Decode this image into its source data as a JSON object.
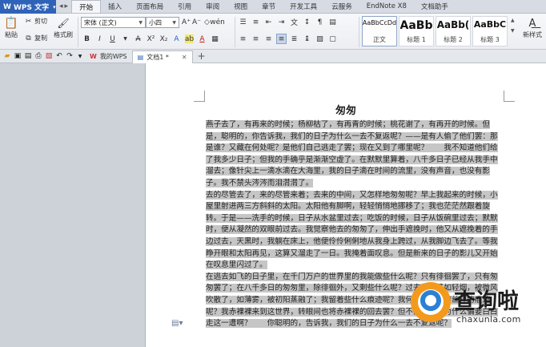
{
  "app": {
    "name": "WPS 文字",
    "menu_tabs": [
      "开始",
      "插入",
      "页面布局",
      "引用",
      "审阅",
      "视图",
      "章节",
      "开发工具",
      "云服务",
      "EndNote X8",
      "文档助手"
    ]
  },
  "ribbon": {
    "paste": "粘贴",
    "cut": "剪切",
    "copy": "复制",
    "format_painter": "格式刷",
    "font_name": "宋体 (正文)",
    "font_size": "小四",
    "bold": "B",
    "italic": "I",
    "underline": "U",
    "styles": [
      {
        "sample": "AaBbCcDd",
        "name": "正文"
      },
      {
        "sample": "AaBb",
        "name": "标题 1"
      },
      {
        "sample": "AaBb(",
        "name": "标题 2"
      },
      {
        "sample": "AaBbC",
        "name": "标题 3"
      }
    ],
    "new_style": "新样式"
  },
  "docbar": {
    "tabs": [
      {
        "label": "我的WPS"
      },
      {
        "label": "文档1 *"
      }
    ],
    "new_tab": "+"
  },
  "document": {
    "title": "匆匆",
    "paragraphs": [
      "燕子去了，有再来的时候；杨柳枯了，有再青的时候；桃花谢了，有再开的时候。但是，聪明的，你告诉我，我们的日子为什么一去不复返呢？——是有人偷了他们罢：那是谁？又藏在何处呢？是他们自己逃走了罢；现在又到了哪里呢？　　我不知道他们给了我多少日子；但我的手确乎是渐渐空虚了。在默默里算着，八千多日子已经从我手中溜去；像针尖上一滴水滴在大海里，我的日子滴在时间的流里，没有声音，也没有影子。我不禁头涔涔而泪潸潸了。",
      "去的尽管去了，来的尽管来着；去来的中间，又怎样地匆匆呢？早上我起来的时候，小屋里射进两三方斜斜的太阳。太阳他有脚啊，轻轻悄悄地挪移了；我也茫茫然跟着旋转。于是——洗手的时候，日子从水盆里过去；吃饭的时候，日子从饭碗里过去；默默时，便从凝然的双眼前过去。我觉察他去的匆匆了，伸出手遮挽时，他又从遮挽着的手边过去，天黑时，我躺在床上，他便伶伶俐俐地从我身上跨过，从我脚边飞去了。等我睁开眼和太阳再见，这算又溜走了一日。我掩着面叹息。但是新来的日子的影儿又开始在叹息里闪过了。",
      "在逃去如飞的日子里，在千门万户的世界里的我能做些什么呢？只有徘徊罢了，只有匆匆罢了；在八千多日的匆匆里，除徘徊外，又剩些什么呢？过去的日子如轻烟，被微风吹散了，如薄雾，被初阳蒸融了；我留着些什么痕迹呢？我何曾留着像游丝样的痕迹呢？我赤裸裸来到这世界，转眼间也将赤裸裸的回去罢？但不能平的，为什么偏要白白走这一遭啊？　　你聪明的，告诉我，我们的日子为什么一去不复返呢？"
    ]
  },
  "watermark": {
    "brand": "查询啦",
    "url": "chaxunla.com"
  }
}
